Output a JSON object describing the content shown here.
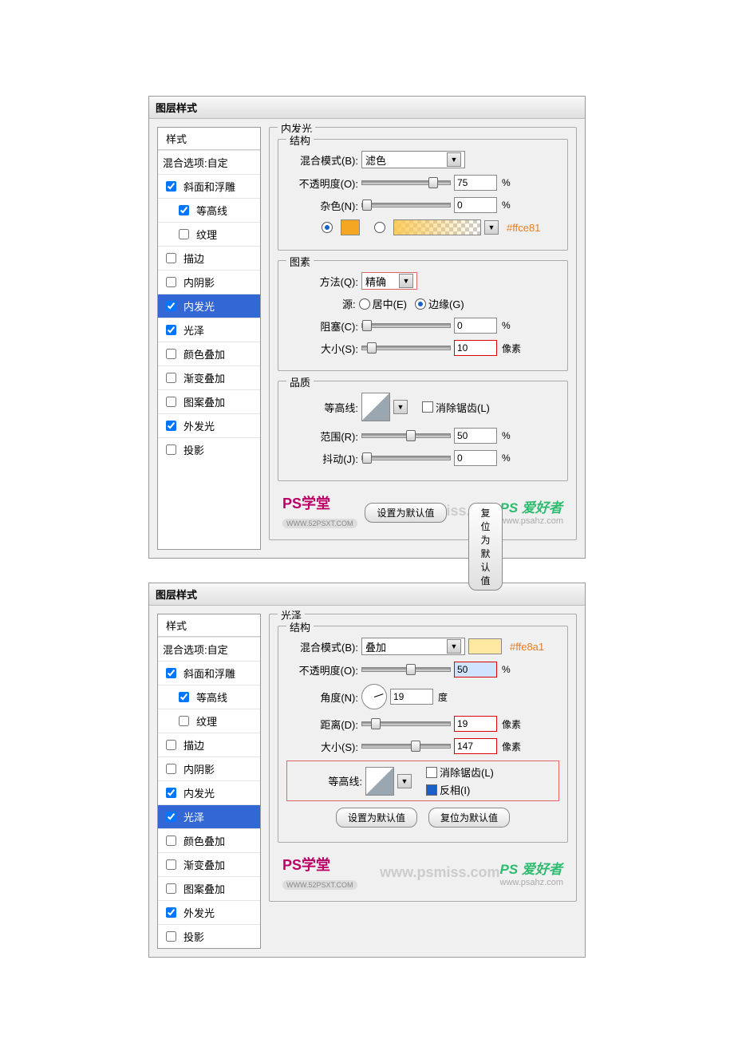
{
  "panel1": {
    "title": "图层样式",
    "styles_header": "样式",
    "blend_options": "混合选项:自定",
    "items": [
      {
        "label": "斜面和浮雕",
        "checked": true,
        "indent": false
      },
      {
        "label": "等高线",
        "checked": true,
        "indent": true
      },
      {
        "label": "纹理",
        "checked": false,
        "indent": true
      },
      {
        "label": "描边",
        "checked": false,
        "indent": false
      },
      {
        "label": "内阴影",
        "checked": false,
        "indent": false
      },
      {
        "label": "内发光",
        "checked": true,
        "indent": false,
        "selected": true
      },
      {
        "label": "光泽",
        "checked": true,
        "indent": false
      },
      {
        "label": "颜色叠加",
        "checked": false,
        "indent": false
      },
      {
        "label": "渐变叠加",
        "checked": false,
        "indent": false
      },
      {
        "label": "图案叠加",
        "checked": false,
        "indent": false
      },
      {
        "label": "外发光",
        "checked": true,
        "indent": false
      },
      {
        "label": "投影",
        "checked": false,
        "indent": false
      }
    ],
    "group_main": "内发光",
    "group_struct": "结构",
    "blend_label": "混合模式(B):",
    "blend_value": "滤色",
    "opacity_label": "不透明度(O):",
    "opacity_value": "75",
    "opacity_unit": "%",
    "noise_label": "杂色(N):",
    "noise_value": "0",
    "noise_unit": "%",
    "color_hex": "#ffce81",
    "group_element": "图素",
    "method_label": "方法(Q):",
    "method_value": "精确",
    "source_label": "源:",
    "source_center": "居中(E)",
    "source_edge": "边缘(G)",
    "choke_label": "阻塞(C):",
    "choke_value": "0",
    "choke_unit": "%",
    "size_label": "大小(S):",
    "size_value": "10",
    "size_unit": "像素",
    "group_quality": "品质",
    "contour_label": "等高线:",
    "antialias_label": "消除锯齿(L)",
    "range_label": "范围(R):",
    "range_value": "50",
    "range_unit": "%",
    "jitter_label": "抖动(J):",
    "jitter_value": "0",
    "jitter_unit": "%",
    "btn_default": "设置为默认值",
    "btn_reset": "复位为默认值",
    "wm_url": "WWW.psmiss.com",
    "wm_left": "PS学堂",
    "wm_left2": "WWW.52PSXT.COM",
    "wm_right": "PS 爱好者",
    "wm_right_sub": "www.psahz.com"
  },
  "panel2": {
    "title": "图层样式",
    "styles_header": "样式",
    "blend_options": "混合选项:自定",
    "items": [
      {
        "label": "斜面和浮雕",
        "checked": true,
        "indent": false
      },
      {
        "label": "等高线",
        "checked": true,
        "indent": true
      },
      {
        "label": "纹理",
        "checked": false,
        "indent": true
      },
      {
        "label": "描边",
        "checked": false,
        "indent": false
      },
      {
        "label": "内阴影",
        "checked": false,
        "indent": false
      },
      {
        "label": "内发光",
        "checked": true,
        "indent": false
      },
      {
        "label": "光泽",
        "checked": true,
        "indent": false,
        "selected": true
      },
      {
        "label": "颜色叠加",
        "checked": false,
        "indent": false
      },
      {
        "label": "渐变叠加",
        "checked": false,
        "indent": false
      },
      {
        "label": "图案叠加",
        "checked": false,
        "indent": false
      },
      {
        "label": "外发光",
        "checked": true,
        "indent": false
      },
      {
        "label": "投影",
        "checked": false,
        "indent": false
      }
    ],
    "group_main": "光泽",
    "group_struct": "结构",
    "blend_label": "混合模式(B):",
    "blend_value": "叠加",
    "color_hex": "#ffe8a1",
    "opacity_label": "不透明度(O):",
    "opacity_value": "50",
    "opacity_unit": "%",
    "angle_label": "角度(N):",
    "angle_value": "19",
    "angle_unit": "度",
    "dist_label": "距离(D):",
    "dist_value": "19",
    "dist_unit": "像素",
    "size_label": "大小(S):",
    "size_value": "147",
    "size_unit": "像素",
    "contour_label": "等高线:",
    "antialias_label": "消除锯齿(L)",
    "invert_label": "反相(I)",
    "btn_default": "设置为默认值",
    "btn_reset": "复位为默认值",
    "wm_url": "www.psmiss.com",
    "wm_left": "PS学堂",
    "wm_left2": "WWW.52PSXT.COM",
    "wm_right": "PS 爱好者",
    "wm_right_sub": "www.psahz.com"
  }
}
